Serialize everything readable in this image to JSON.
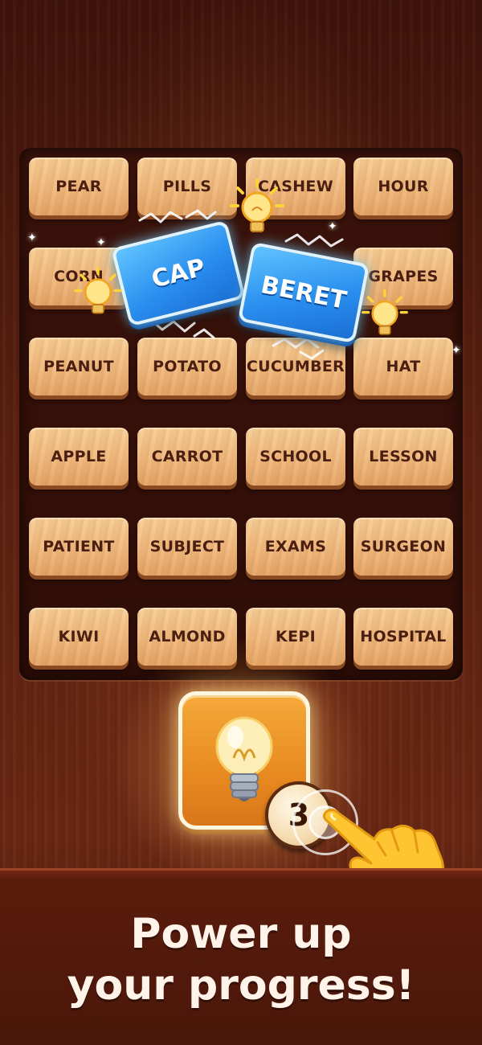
{
  "board": {
    "rows": [
      [
        "PEAR",
        "PILLS",
        "CASHEW",
        "HOUR"
      ],
      [
        "CORN",
        "",
        "",
        "GRAPES"
      ],
      [
        "PEANUT",
        "POTATO",
        "CUCUMBER",
        "HAT"
      ],
      [
        "APPLE",
        "CARROT",
        "SCHOOL",
        "LESSON"
      ],
      [
        "PATIENT",
        "SUBJECT",
        "EXAMS",
        "SURGEON"
      ],
      [
        "KIWI",
        "ALMOND",
        "KEPI",
        "HOSPITAL"
      ]
    ]
  },
  "matched_cards": {
    "left": "CAP",
    "right": "BERET"
  },
  "hint": {
    "icon": "lightbulb-icon",
    "count": "3"
  },
  "tagline": {
    "line1": "Power up",
    "line2": "your progress!"
  },
  "colors": {
    "tile": "#efb87c",
    "tile_text": "#4a1e10",
    "card_blue": "#2a8fef",
    "hint_orange": "#e88a20"
  }
}
